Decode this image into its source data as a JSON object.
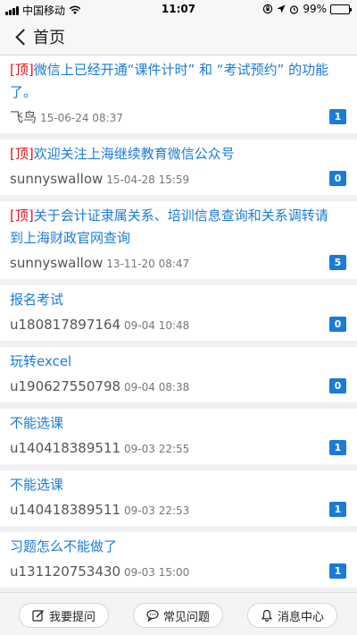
{
  "status": {
    "carrier": "中国移动",
    "time": "11:07",
    "battery_pct": "99%",
    "battery_level": 0.99
  },
  "nav": {
    "back_label": "首页"
  },
  "pin_tag": "[顶]",
  "posts": [
    {
      "pinned": true,
      "title": "微信上已经开通“课件计时” 和 “考试预约” 的功能了。",
      "author": "飞鸟",
      "date": "15-06-24 08:37",
      "count": "1"
    },
    {
      "pinned": true,
      "title": "欢迎关注上海继续教育微信公众号",
      "author": "sunnyswallow",
      "date": "15-04-28 15:59",
      "count": "0"
    },
    {
      "pinned": true,
      "title": "关于会计证隶属关系、培训信息查询和关系调转请到上海财政官网查询",
      "author": "sunnyswallow",
      "date": "13-11-20 08:47",
      "count": "5"
    },
    {
      "pinned": false,
      "title": "报名考试",
      "author": "u180817897164",
      "date": "09-04 10:48",
      "count": "0"
    },
    {
      "pinned": false,
      "title": "玩转excel",
      "author": "u190627550798",
      "date": "09-04 08:38",
      "count": "0"
    },
    {
      "pinned": false,
      "title": "不能选课",
      "author": "u140418389511",
      "date": "09-03 22:55",
      "count": "1"
    },
    {
      "pinned": false,
      "title": "不能选课",
      "author": "u140418389511",
      "date": "09-03 22:53",
      "count": "1"
    },
    {
      "pinned": false,
      "title": "习题怎么不能做了",
      "author": "u131120753430",
      "date": "09-03 15:00",
      "count": "1"
    }
  ],
  "bottom": {
    "ask": "我要提问",
    "faq": "常见问题",
    "messages": "消息中心"
  },
  "colors": {
    "link": "#1a7bd8",
    "pin": "#e0141e",
    "badge": "#1a7bd8"
  }
}
